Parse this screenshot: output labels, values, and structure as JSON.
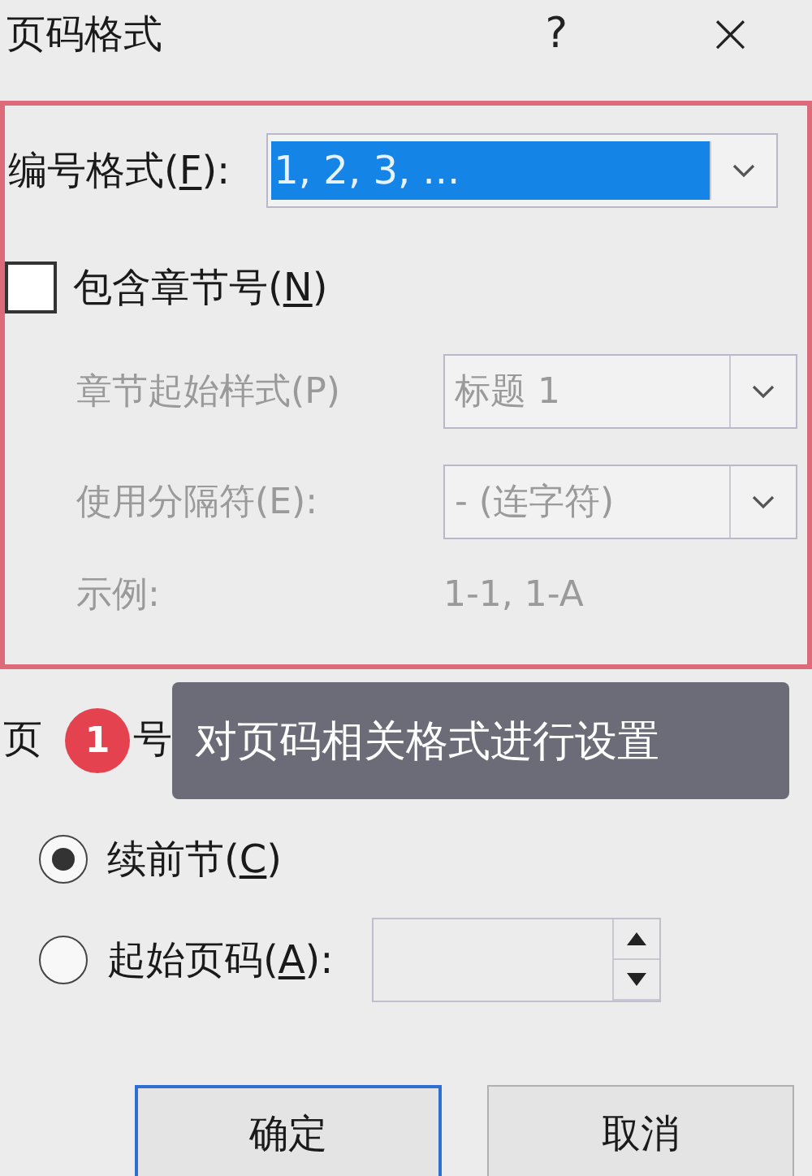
{
  "window": {
    "title": "页码格式",
    "help": "?",
    "close": "×"
  },
  "number_format": {
    "label": {
      "before": "编号格式(",
      "accel": "F",
      "after": "):"
    },
    "value": "1, 2, 3, ..."
  },
  "include_chapter": {
    "label": {
      "before": "包含章节号(",
      "accel": "N",
      "after": ")"
    },
    "checked": false
  },
  "chapter_fields": [
    {
      "kind": "combo",
      "label": "章节起始样式(P)",
      "value": "标题 1",
      "disabled": true
    },
    {
      "kind": "combo",
      "label": "使用分隔符(E):",
      "value": "-  (连字符)",
      "disabled": true
    },
    {
      "kind": "text",
      "label": "示例:",
      "value": "1-1, 1-A",
      "disabled": true
    }
  ],
  "numbering": {
    "label_parts": [
      "页",
      "号"
    ],
    "options": [
      {
        "kind": "radio",
        "label": {
          "before": "续前节(",
          "accel": "C",
          "after": ")"
        },
        "selected": true
      },
      {
        "kind": "spin",
        "label": {
          "before": "起始页码(",
          "accel": "A",
          "after": "):"
        },
        "selected": false
      }
    ]
  },
  "badge": "1",
  "tooltip": "对页码相关格式进行设置",
  "buttons": [
    {
      "label": "确定",
      "default": true
    },
    {
      "label": "取消",
      "default": false
    }
  ]
}
